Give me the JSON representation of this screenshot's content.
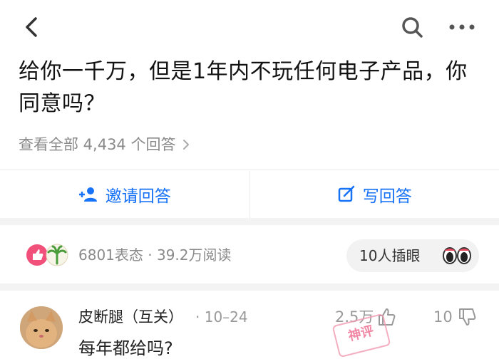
{
  "question": {
    "title": "给你一千万，但是1年内不玩任何电子产品，你同意吗？",
    "view_all": "查看全部 4,434 个回答"
  },
  "actions": {
    "invite_label": "邀请回答",
    "write_label": "写回答"
  },
  "stats": {
    "text": "6801表态 · 39.2万阅读",
    "peek_label": "10人插眼"
  },
  "answer": {
    "author": "皮断腿（互关）",
    "date": "· 10–24",
    "likes": "2.5万",
    "dislikes": "10",
    "stamp": "神评",
    "text_partial": "每年都给吗?"
  },
  "colors": {
    "accent": "#1772f6",
    "muted": "#8a8a8a",
    "band": "#f3f3f3"
  },
  "icons": [
    "back-icon",
    "search-icon",
    "more-icon",
    "add-person-icon",
    "edit-icon",
    "chevron-right-icon",
    "thumb-up-icon",
    "thumb-down-icon",
    "eyes-icon"
  ]
}
